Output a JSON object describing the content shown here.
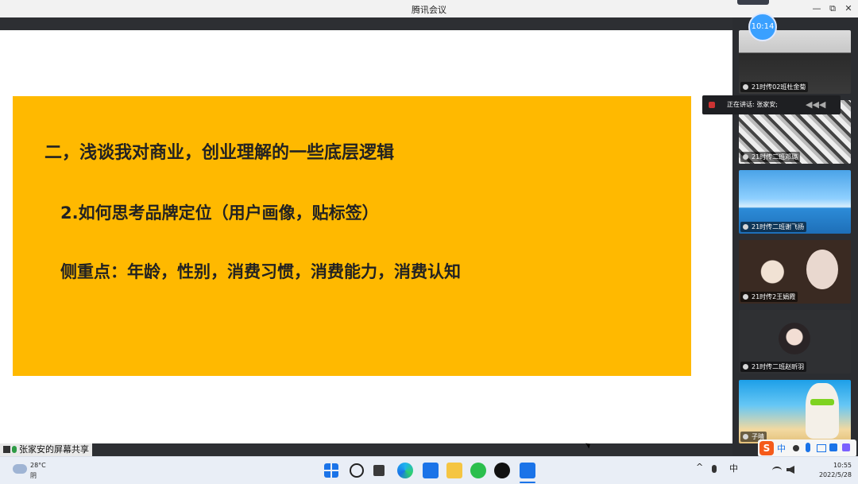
{
  "window": {
    "title": "腾讯会议",
    "min_glyph": "—",
    "restore_glyph": "⧉",
    "close_glyph": "✕"
  },
  "timer": "10:14",
  "slide": {
    "heading": "二，浅谈我对商业，创业理解的一些底层逻辑",
    "subheading": "2.如何思考品牌定位（用户画像，贴标签）",
    "focus": "侧重点：年龄，性别，消费习惯，消费能力，消费认知",
    "background": "#ffb900"
  },
  "share_bar": {
    "label": "张家安的屏幕共享"
  },
  "speaking": {
    "text": "正在讲话: 张家安;",
    "waves": "◀◀◀"
  },
  "participants": [
    {
      "name": "21时传02班杜金菊"
    },
    {
      "name": "21时传二班邓璐"
    },
    {
      "name": "21时传二班谢飞扬"
    },
    {
      "name": "21时传2王娟霞"
    },
    {
      "name": "21时传二班赵昕羽"
    },
    {
      "name": "子晴"
    }
  ],
  "taskbar": {
    "weather": {
      "temp": "28°C",
      "condition": "阴"
    },
    "apps": [
      "windows-start",
      "search",
      "task-view",
      "edge",
      "meeting",
      "file-explorer",
      "wechat",
      "qq",
      "tencent-meeting"
    ],
    "tray": {
      "chevron": "^",
      "input_lang": "中",
      "ime_label": "中"
    },
    "clock": {
      "time": "10:55",
      "date": "2022/5/28"
    }
  },
  "colors": {
    "accent": "#1a73e8",
    "panel_bg": "#2b2d31",
    "slide_bg": "#ffb900"
  }
}
